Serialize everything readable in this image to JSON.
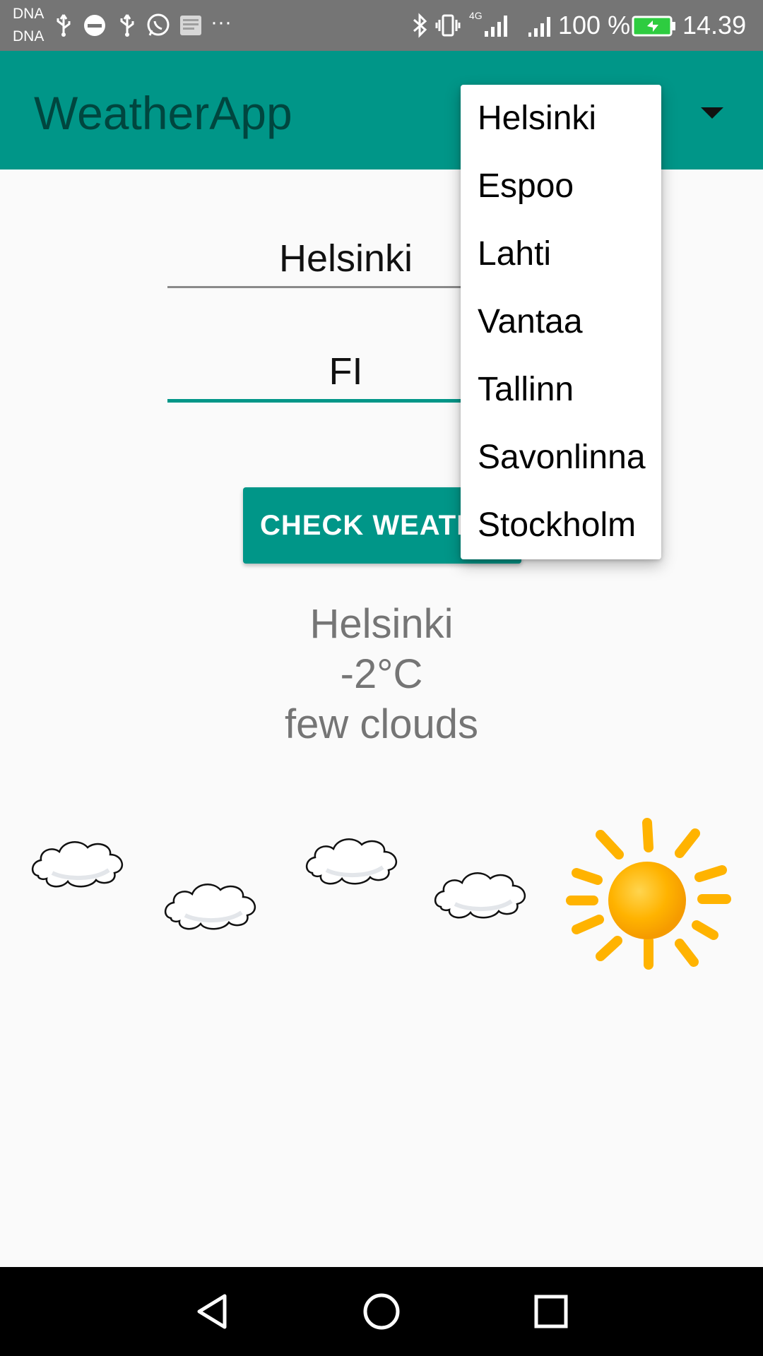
{
  "status_bar": {
    "carrier_1": "DNA",
    "carrier_2": "DNA",
    "more_notifications": "···",
    "network_type": "4G",
    "battery": "100 %",
    "time": "14.39",
    "icons": [
      "usb-icon",
      "data-saver-icon",
      "usb-icon",
      "whatsapp-icon",
      "bible-app-icon",
      "bluetooth-icon",
      "vibrate-icon",
      "signal-icon",
      "signal-icon",
      "battery-charging-icon"
    ]
  },
  "app_bar": {
    "title": "WeatherApp",
    "spinner_icon": "dropdown-arrow-icon"
  },
  "form": {
    "city_value": "Helsinki",
    "country_value": "FI",
    "check_button": "CHECK WEATHER"
  },
  "weather": {
    "city": "Helsinki",
    "temperature": "-2°C",
    "description": "few clouds",
    "illustration": [
      "cloud-icon",
      "cloud-icon",
      "cloud-icon",
      "cloud-icon",
      "sun-icon"
    ]
  },
  "dropdown": {
    "items": [
      "Helsinki",
      "Espoo",
      "Lahti",
      "Vantaa",
      "Tallinn",
      "Savonlinna",
      "Stockholm"
    ]
  },
  "nav_bar": {
    "icons": [
      "back-icon",
      "home-icon",
      "recents-icon"
    ]
  },
  "colors": {
    "primary": "#009688",
    "primary_dark_text": "#00463f",
    "status_bar": "#757575",
    "result_text": "#757575",
    "sun": "#ffb300",
    "battery_fill": "#2ecc40"
  }
}
